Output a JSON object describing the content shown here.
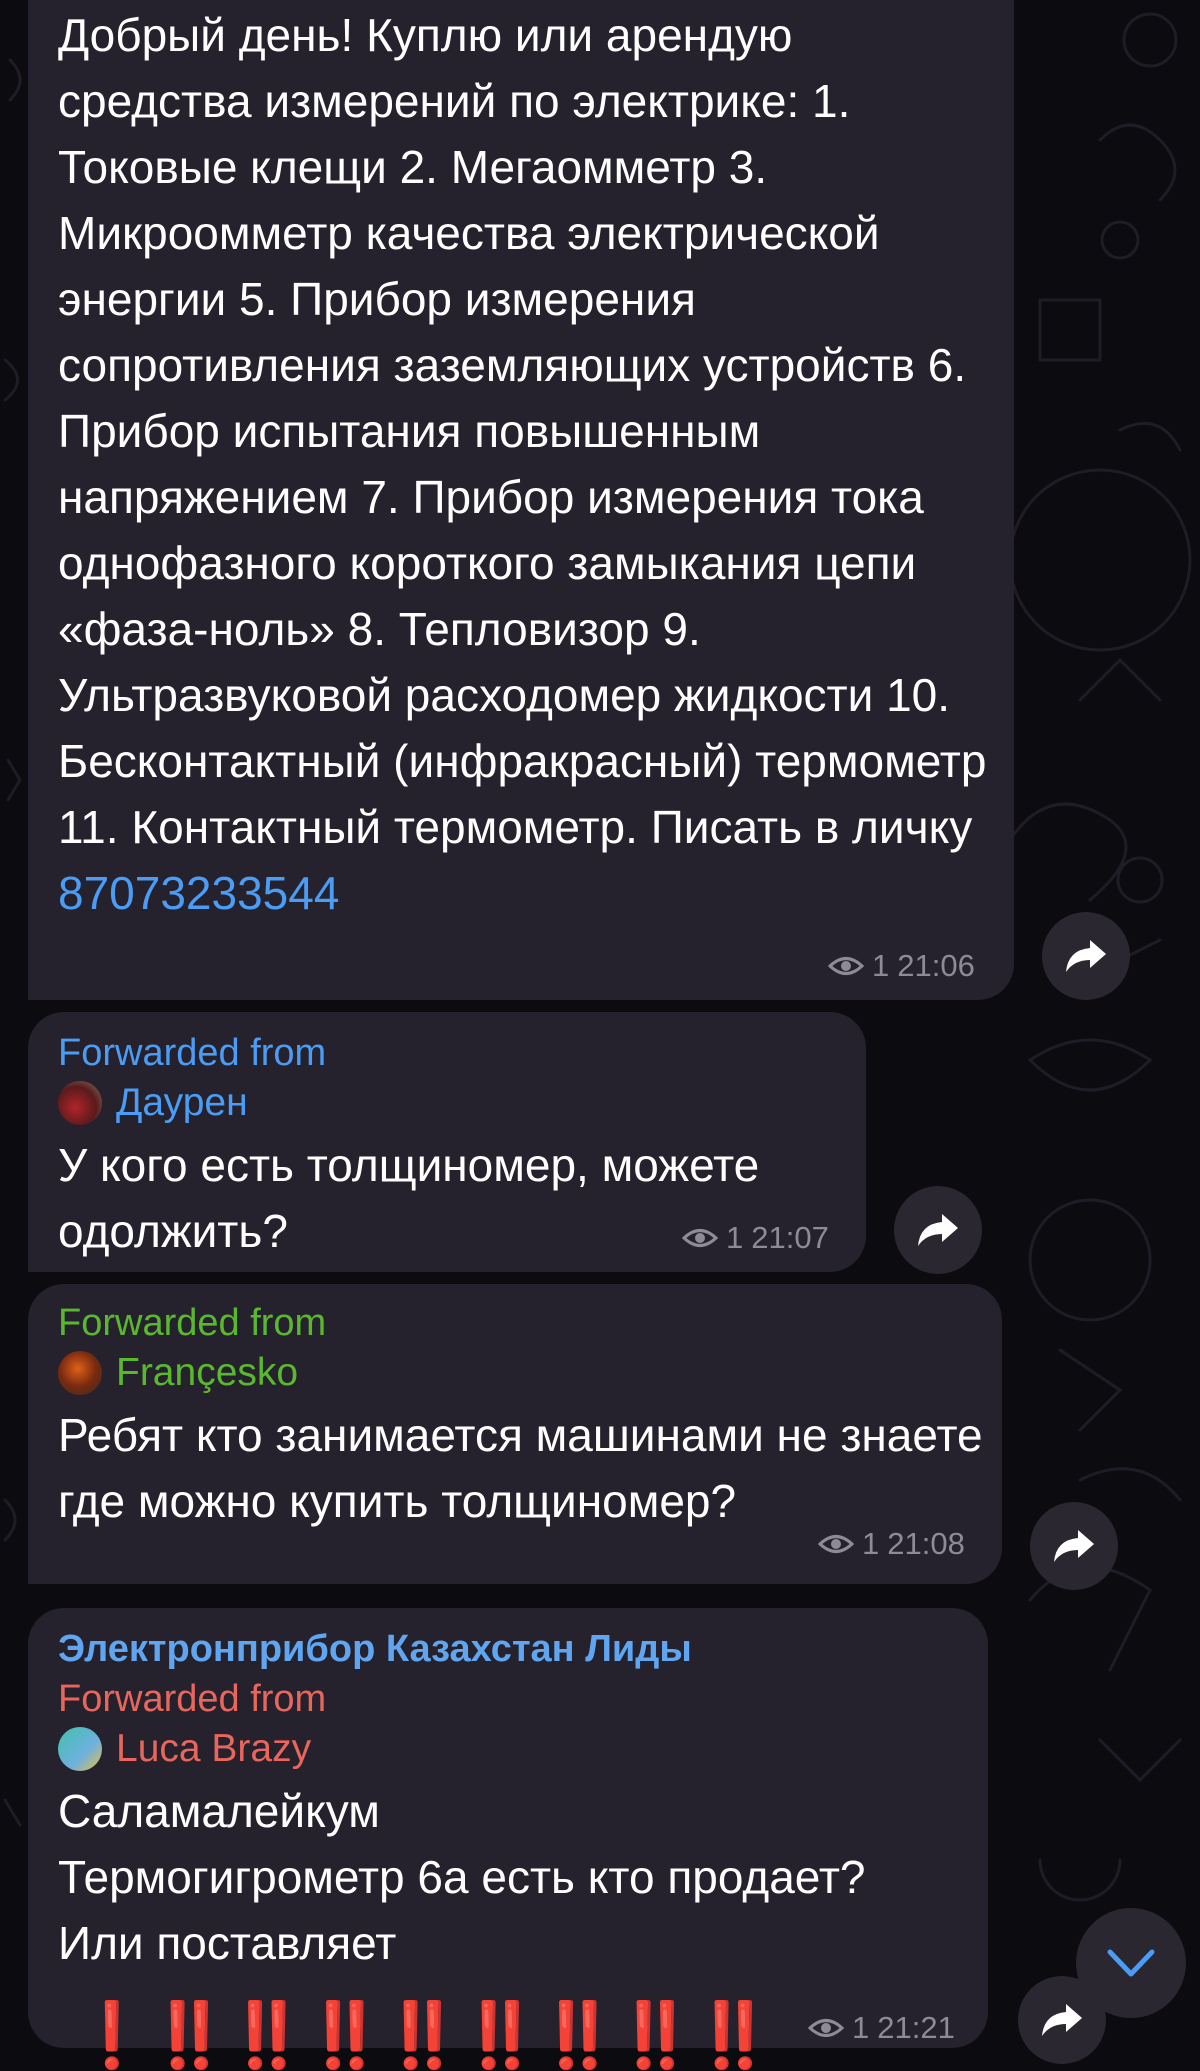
{
  "messages": [
    {
      "text": "Добрый день! Куплю или арендую средства измерений по электрике: 1. Токовые клещи 2. Мегаомметр 3. Микроомметр качества электрической энергии 5. Прибор измерения сопротивления заземляющих устройств 6. Прибор испытания повышенным напряжением 7. Прибор измерения тока однофазного короткого замыкания цепи «фаза-ноль» 8. Тепловизор 9. Ультразвуковой расходомер жидкости 10. Бесконтактный (инфракрасный) термометр 11. Контактный термометр. Писать в личку ",
      "phone": "87073233544",
      "views": "1",
      "time": "21:06"
    },
    {
      "forwarded_label": "Forwarded from",
      "forwarded_name": "Даурен",
      "text": "У кого есть толщиномер, можете одолжить?",
      "views": "1",
      "time": "21:07"
    },
    {
      "forwarded_label": "Forwarded from",
      "forwarded_name": "Françesko",
      "text": "Ребят кто занимается машинами не знаете где можно купить толщиномер?",
      "views": "1",
      "time": "21:08"
    },
    {
      "sender": "Электронприбор Казахстан Лиды",
      "forwarded_label": "Forwarded from",
      "forwarded_name": "Luca Brazy",
      "text": "Саламалейкум\nТермогигрометр 6а есть кто продает?\nИли поставляет",
      "emoji_line": "❗‼️‼️‼️‼️‼️‼️‼️‼️",
      "views": "1",
      "time": "21:21"
    }
  ],
  "colors": {
    "background": "#0c0b10",
    "bubble": "#25222d",
    "link": "#4a9cf5",
    "forward_blue": "#4a9cf5",
    "forward_green": "#5ab82e",
    "forward_red": "#e8665c",
    "sender_blue": "#5fa5f0",
    "meta": "#8e8a98"
  },
  "icons": {
    "share": "share-arrow-icon",
    "views": "eye-icon",
    "scroll_down": "chevron-down-icon"
  }
}
